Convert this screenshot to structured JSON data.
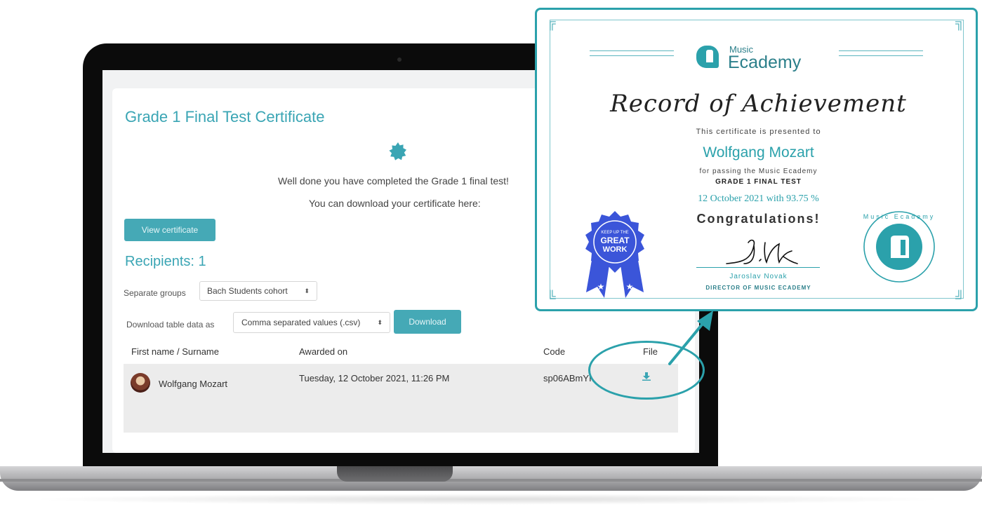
{
  "page": {
    "title": "Grade 1 Final Test Certificate",
    "message_line1": "Well done you have completed the Grade 1 final test!",
    "message_line2": "You can download your certificate here:",
    "view_button": "View certificate",
    "recipients_heading": "Recipients: 1",
    "separate_groups_label": "Separate groups",
    "separate_groups_value": "Bach Students cohort",
    "download_label": "Download table data as",
    "download_format_value": "Comma separated values (.csv)",
    "download_button": "Download"
  },
  "table": {
    "headers": [
      "First name / Surname",
      "Awarded on",
      "Code",
      "File"
    ],
    "rows": [
      {
        "name": "Wolfgang Mozart",
        "awarded_on": "Tuesday, 12 October 2021, 11:26 PM",
        "code": "sp06ABmYI",
        "file_icon": "download-icon"
      }
    ]
  },
  "certificate": {
    "brand_small": "Music",
    "brand_big": "Ecademy",
    "title": "Record of Achievement",
    "presented_to": "This certificate is presented to",
    "recipient": "Wolfgang Mozart",
    "for_line": "for passing the Music Ecademy",
    "test_name": "GRADE 1 FINAL TEST",
    "date_score": "12 October 2021 with  93.75 %",
    "congrats": "Congratulations!",
    "signature": "J.Novak",
    "signer": "Jaroslav Novak",
    "signer_role": "DIRECTOR OF MUSIC ECADEMY",
    "ribbon_top": "KEEP UP THE",
    "ribbon_line1": "GREAT",
    "ribbon_line2": "WORK",
    "seal_text": "Music Ecademy"
  },
  "colors": {
    "accent": "#3aa5b4",
    "button": "#45a9b6",
    "callout": "#2ba1ab",
    "ribbon": "#3b55d9"
  }
}
